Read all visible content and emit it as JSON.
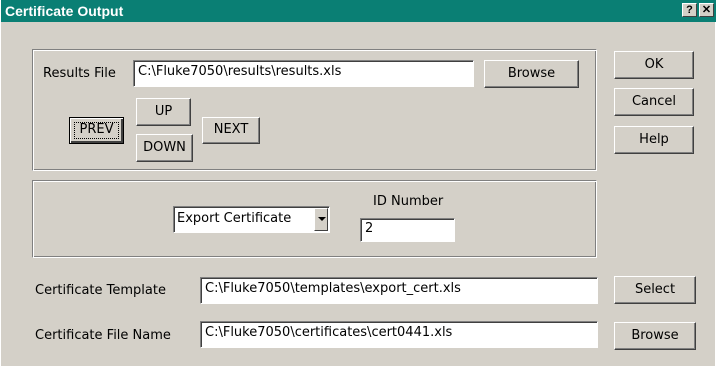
{
  "window": {
    "title": "Certificate Output",
    "help_button": "?",
    "close_button": "✕"
  },
  "results": {
    "label": "Results File",
    "value": "C:\\Fluke7050\\results\\results.xls",
    "browse_label": "Browse",
    "prev_label": "PREV",
    "up_label": "UP",
    "down_label": "DOWN",
    "next_label": "NEXT"
  },
  "actions": {
    "ok_label": "OK",
    "cancel_label": "Cancel",
    "help_label": "Help"
  },
  "export": {
    "type_selected": "Export Certificate",
    "id_label": "ID Number",
    "id_value": "2"
  },
  "template": {
    "label": "Certificate Template",
    "value": "C:\\Fluke7050\\templates\\export_cert.xls",
    "select_label": "Select"
  },
  "file_name": {
    "label": "Certificate File Name",
    "value": "C:\\Fluke7050\\certificates\\cert0441.xls",
    "browse_label": "Browse"
  }
}
